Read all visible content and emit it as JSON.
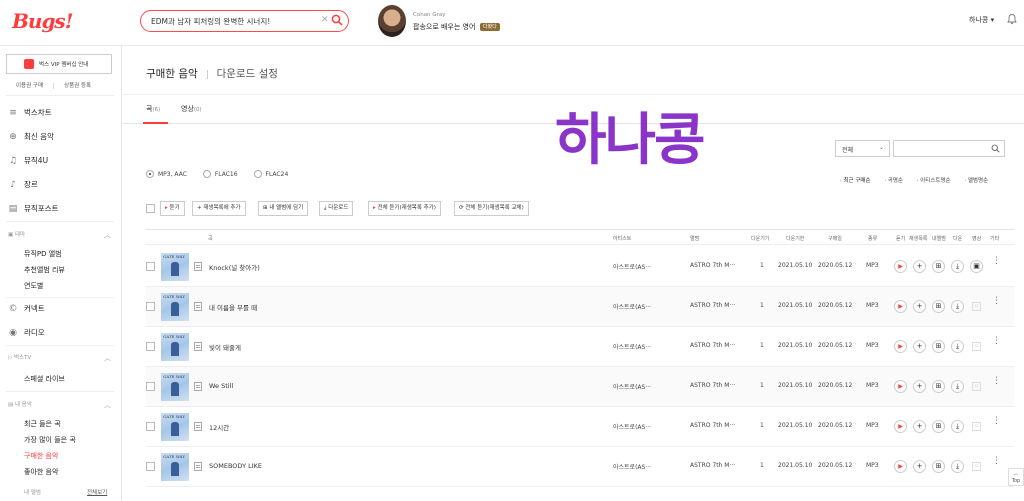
{
  "header": {
    "logo": "Bugs!",
    "search_value": "EDM과 남자 피처링의 완벽한 시너지!",
    "promo_artist": "Conan Gray",
    "promo_title": "팝송으로 배우는 영어",
    "promo_badge": "다봤다",
    "user_name": "하나콩",
    "user_caret": "▾"
  },
  "sidebar": {
    "vip_label": "벅스 VIP 멤버십 안내",
    "link_buy": "이용권 구매",
    "link_register": "상품권 등록",
    "nav": [
      "벅스차트",
      "최신 음악",
      "뮤직4U",
      "장르",
      "뮤직포스트"
    ],
    "theme_header": "테마",
    "theme_items": [
      "뮤직PD 앨범",
      "추천앨범 리뷰",
      "연도별"
    ],
    "nav2": [
      "커넥트",
      "라디오"
    ],
    "tv_header": "벅스TV",
    "tv_items": [
      "스페셜 라이브"
    ],
    "my_header": "내 음악",
    "my_items": [
      "최근 들은 곡",
      "가장 많이 들은 곡",
      "구매한 음악",
      "좋아한 음악"
    ],
    "my_album": "내 앨범",
    "see_all": "전체보기"
  },
  "page": {
    "title": "구매한 음악",
    "subtitle": "다운로드 설정",
    "tab_songs": "곡",
    "tab_songs_count": "(6)",
    "tab_videos": "영상",
    "tab_videos_count": "(0)",
    "overlay_name": "하나콩"
  },
  "filters": {
    "select_value": "전체",
    "formats": [
      "MP3, AAC",
      "FLAC16",
      "FLAC24"
    ],
    "sort": [
      "최근 구매순",
      "곡명순",
      "아티스트명순",
      "앨범명순"
    ]
  },
  "toolbar": {
    "listen": "듣기",
    "add_playlist": "재생목록에 추가",
    "add_album": "내 앨범에 담기",
    "download": "다운로드",
    "listen_all_add": "전체 듣기(재생목록 추가)",
    "listen_all_replace": "전체 듣기(재생목록 교체)"
  },
  "table": {
    "headers": [
      "곡",
      "아티스트",
      "앨범",
      "다운기기",
      "다운기한",
      "구매일",
      "종류",
      "듣기",
      "재생목록",
      "내앨범",
      "다운",
      "영상",
      "기타"
    ],
    "rows": [
      {
        "title": "Knock(널 찾아가)",
        "artist": "아스트로(AS···",
        "album": "ASTRO 7th M···",
        "devices": "1",
        "expire": "2021.05.10",
        "purchased": "2020.05.12",
        "type": "MP3",
        "has_mv": true
      },
      {
        "title": "내 이름을 부를 때",
        "artist": "아스트로(AS···",
        "album": "ASTRO 7th M···",
        "devices": "1",
        "expire": "2021.05.10",
        "purchased": "2020.05.12",
        "type": "MP3",
        "has_mv": false
      },
      {
        "title": "빛이 돼줄게",
        "artist": "아스트로(AS···",
        "album": "ASTRO 7th M···",
        "devices": "1",
        "expire": "2021.05.10",
        "purchased": "2020.05.12",
        "type": "MP3",
        "has_mv": false
      },
      {
        "title": "We Still",
        "artist": "아스트로(AS···",
        "album": "ASTRO 7th M···",
        "devices": "1",
        "expire": "2021.05.10",
        "purchased": "2020.05.12",
        "type": "MP3",
        "has_mv": false
      },
      {
        "title": "12시간",
        "artist": "아스트로(AS···",
        "album": "ASTRO 7th M···",
        "devices": "1",
        "expire": "2021.05.10",
        "purchased": "2020.05.12",
        "type": "MP3",
        "has_mv": false
      },
      {
        "title": "SOMEBODY LIKE",
        "artist": "아스트로(AS···",
        "album": "ASTRO 7th M···",
        "devices": "1",
        "expire": "2021.05.10",
        "purchased": "2020.05.12",
        "type": "MP3",
        "has_mv": false
      }
    ],
    "album_art_text": "GATE WAY"
  },
  "top_button": "Top",
  "colors": {
    "accent": "#ff3c3c",
    "overlay": "#8a34c9"
  }
}
